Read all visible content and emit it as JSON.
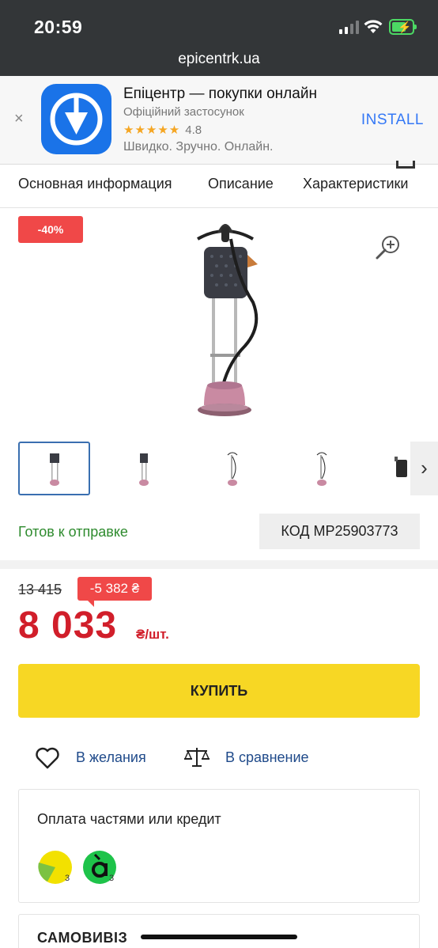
{
  "status_bar": {
    "time": "20:59",
    "url": "epicentrk.ua"
  },
  "app_banner": {
    "close": "×",
    "title": "Епіцентр — покупки онлайн",
    "subtitle": "Офіційний застосунок",
    "stars": "★★★★★",
    "rating": "4.8",
    "description": "Швидко. Зручно. Онлайн.",
    "install": "INSTALL"
  },
  "tabs": [
    "Основная информация",
    "Описание",
    "Характеристики"
  ],
  "product": {
    "discount_badge": "-40%",
    "thumbnails_count": 5,
    "thumb_next": "›",
    "availability": "Готов к отправке",
    "code": "КОД MP25903773"
  },
  "price": {
    "old": "13 415",
    "saving": "-5 382 ₴",
    "current": "8 033",
    "unit": "₴/шт.",
    "buy_label": "КУПИТЬ"
  },
  "actions": {
    "wishlist": "В желания",
    "compare": "В сравнение"
  },
  "credit": {
    "title": "Оплата частями или кредит",
    "banks": [
      {
        "badge": "3",
        "color": "#f2e100"
      },
      {
        "badge": "3",
        "color": "#1ec34a"
      }
    ]
  },
  "pickup": {
    "title": "САМОВИВІЗ"
  },
  "colors": {
    "accent_red": "#d11e2a",
    "buy_yellow": "#f7d724",
    "link_blue": "#1f4a8a",
    "ready_green": "#2e8b2e"
  }
}
